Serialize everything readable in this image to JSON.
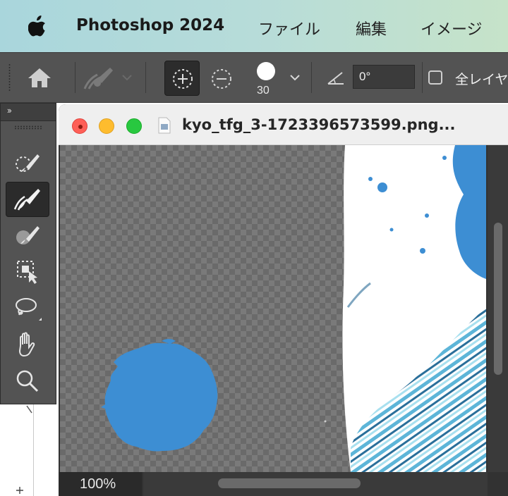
{
  "menubar": {
    "app_name": "Photoshop 2024",
    "items": [
      "ファイル",
      "編集",
      "イメージ"
    ]
  },
  "options": {
    "brush_size": "30",
    "angle_value": "0°",
    "checkbox_label": "全レイヤ"
  },
  "document": {
    "title": "kyo_tfg_3-1723396573599.png...",
    "zoom": "100%"
  },
  "tools": [
    "quick-selection",
    "refine-edge-brush",
    "brush",
    "object-selection",
    "lasso",
    "hand",
    "zoom"
  ],
  "colors": {
    "accent_blue": "#3d8ed3",
    "selected_tool_bg": "#2b2b2b"
  }
}
